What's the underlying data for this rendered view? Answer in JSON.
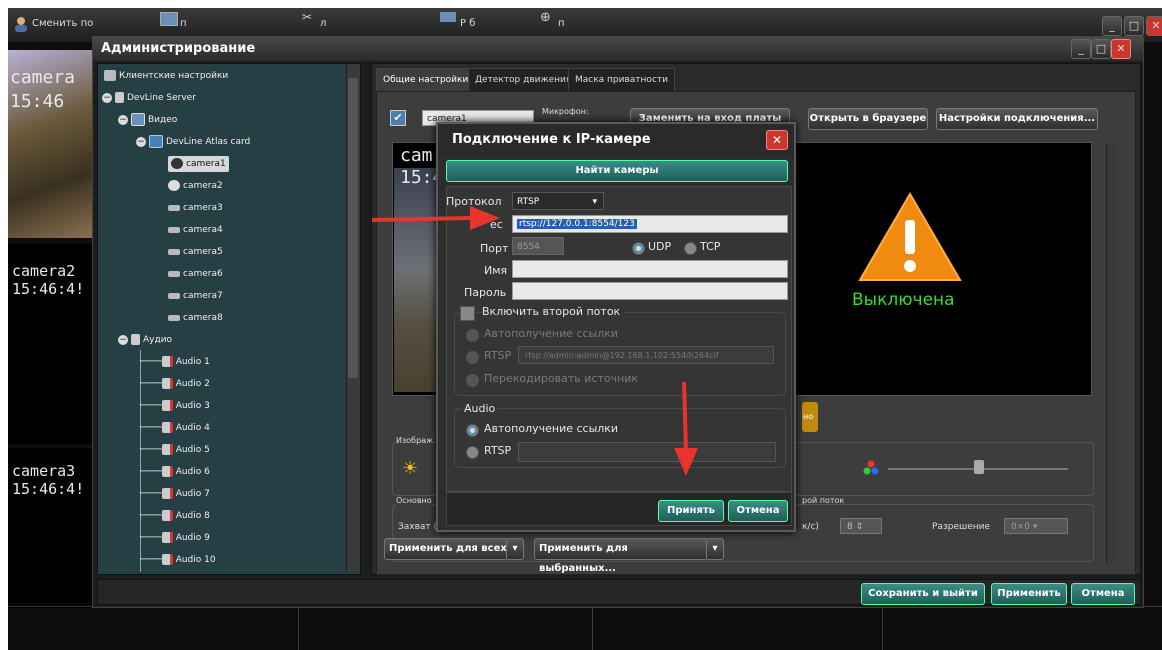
{
  "taskbar": {
    "change_user": "Сменить по",
    "items": [
      "п",
      "л",
      "Р б",
      "п"
    ]
  },
  "cams": [
    {
      "name": "camera",
      "time": "15:46"
    },
    {
      "name": "camera2",
      "time": "15:46:4!"
    },
    {
      "name": "camera3",
      "time": "15:46:4!"
    }
  ],
  "admin": {
    "title": "Администрирование",
    "tree": {
      "client_settings": "Клиентские настройки",
      "server": "DevLine Server",
      "video": "Видео",
      "card": "DevLine Atlas card",
      "cameras": [
        "camera1",
        "camera2",
        "camera3",
        "camera4",
        "camera5",
        "camera6",
        "camera7",
        "camera8"
      ],
      "audio": "Аудио",
      "audio_items": [
        "Audio 1",
        "Audio 2",
        "Audio 3",
        "Audio 4",
        "Audio 5",
        "Audio 6",
        "Audio 7",
        "Audio 8",
        "Audio 9",
        "Audio 10"
      ]
    },
    "tabs": [
      "Общие настройки",
      "Детектор движения",
      "Маска приватности"
    ],
    "camera_name_value": "camera1",
    "mic_label": "Микрофон:",
    "btn_replace": "Заменить на вход платы",
    "btn_open_browser": "Открыть в браузере",
    "btn_connection": "Настройки подключения...",
    "preview": {
      "name": "cam",
      "time": "15:4"
    },
    "status_off": "Выключена",
    "badge_partial": "но",
    "image_label": "Изображ",
    "main_label": "Основно",
    "capture_label": "Захват (",
    "second_stream_label": "рой поток",
    "fps_label": "к/с)",
    "fps_value": "8",
    "resolution_label": "Разрешение",
    "resolution_value": "0×0",
    "apply_all": "Применить для всех",
    "apply_selected": "Применить для выбранных...",
    "save_exit": "Сохранить и выйти",
    "apply": "Применить",
    "cancel": "Отмена"
  },
  "dialog": {
    "title": "Подключение к IP-камере",
    "find": "Найти камеры",
    "protocol_label": "Протокол",
    "protocol_value": "RTSP",
    "address_label": "ес",
    "address_value": "rtsp://127.0.0.1:8554/123",
    "port_label": "Порт",
    "port_value": "8554",
    "udp": "UDP",
    "tcp": "TCP",
    "name_label": "Имя",
    "password_label": "Пароль",
    "second_stream": "Включить второй поток",
    "auto_link": "Автополучение ссылки",
    "rtsp": "RTSP",
    "rtsp_placeholder": "rtsp://admin:admin@192.168.1.102:554/h264cif",
    "transcode": "Перекодировать источник",
    "audio_group": "Audio",
    "audio_auto": "Автополучение ссылки",
    "audio_rtsp": "RTSP",
    "accept": "Принять",
    "cancel": "Отмена"
  },
  "colors": {
    "arrow": "#e8352b",
    "warning": "#f08a10",
    "status_green": "#33dd33",
    "close_red": "#c8362c"
  }
}
